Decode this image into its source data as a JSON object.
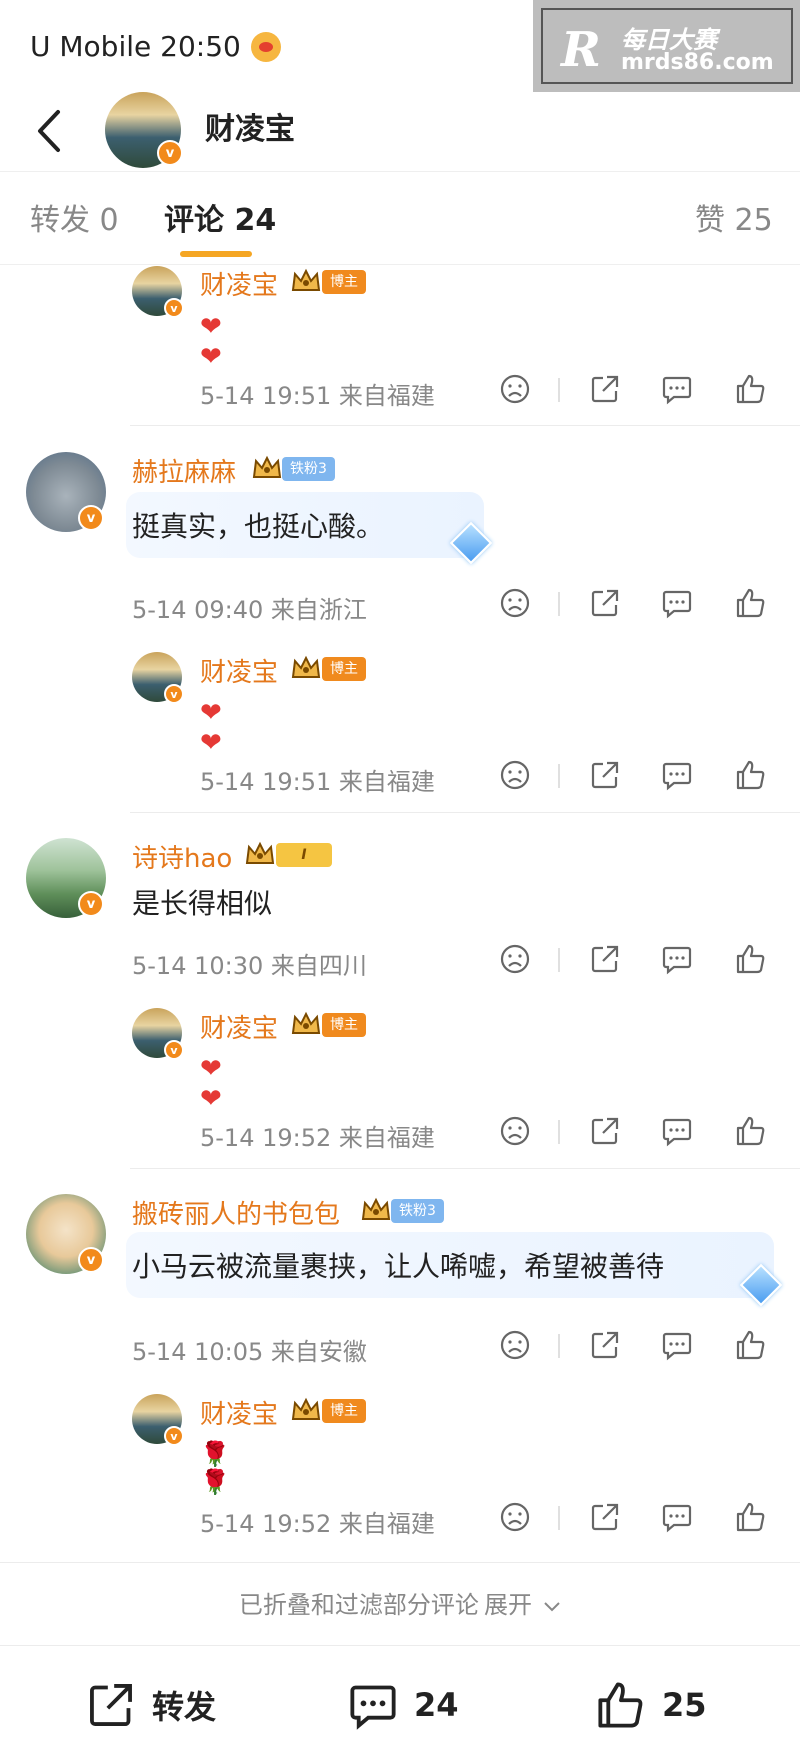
{
  "status_bar": {
    "carrier_time": "U Mobile 20:50"
  },
  "watermark": {
    "logo": "R",
    "title": "每日大赛",
    "site": "mrds86.com"
  },
  "header": {
    "author": "财凌宝"
  },
  "tabs": [
    {
      "label": "转发 0"
    },
    {
      "label": "评论 24"
    },
    {
      "label": "赞 25"
    }
  ],
  "badges": {
    "blogger": "博主",
    "iron_fan": "铁粉3",
    "level": "I",
    "verified": "v"
  },
  "comments": [
    {
      "name": "财凌宝",
      "text": "❤❤",
      "time": "5-14 19:51",
      "location": "来自福建"
    },
    {
      "name": "赫拉麻麻",
      "text": "挺真实，也挺心酸。",
      "time": "5-14 09:40",
      "location": "来自浙江"
    },
    {
      "name": "财凌宝",
      "text": "❤❤",
      "time": "5-14 19:51",
      "location": "来自福建"
    },
    {
      "name": "诗诗hao",
      "text": "是长得相似",
      "time": "5-14 10:30",
      "location": "来自四川"
    },
    {
      "name": "财凌宝",
      "text": "❤❤",
      "time": "5-14 19:52",
      "location": "来自福建"
    },
    {
      "name": "搬砖丽人的书包包",
      "text": "小马云被流量裹挟，让人唏嘘，希望被善待",
      "time": "5-14 10:05",
      "location": "来自安徽"
    },
    {
      "name": "财凌宝",
      "text": "🌹🌹",
      "time": "5-14 19:52",
      "location": "来自福建"
    }
  ],
  "fold": {
    "label": "已折叠和过滤部分评论",
    "expand": "展开"
  },
  "bottom_bar": {
    "repost": "转发",
    "comments": "24",
    "likes": "25"
  },
  "colors": {
    "accent": "#f5a623",
    "name": "#e4781c",
    "badge": "#f08a1e"
  },
  "icons": [
    "back-icon",
    "dislike-icon",
    "share-icon",
    "comment-icon",
    "like-icon",
    "chevron-down-icon"
  ]
}
